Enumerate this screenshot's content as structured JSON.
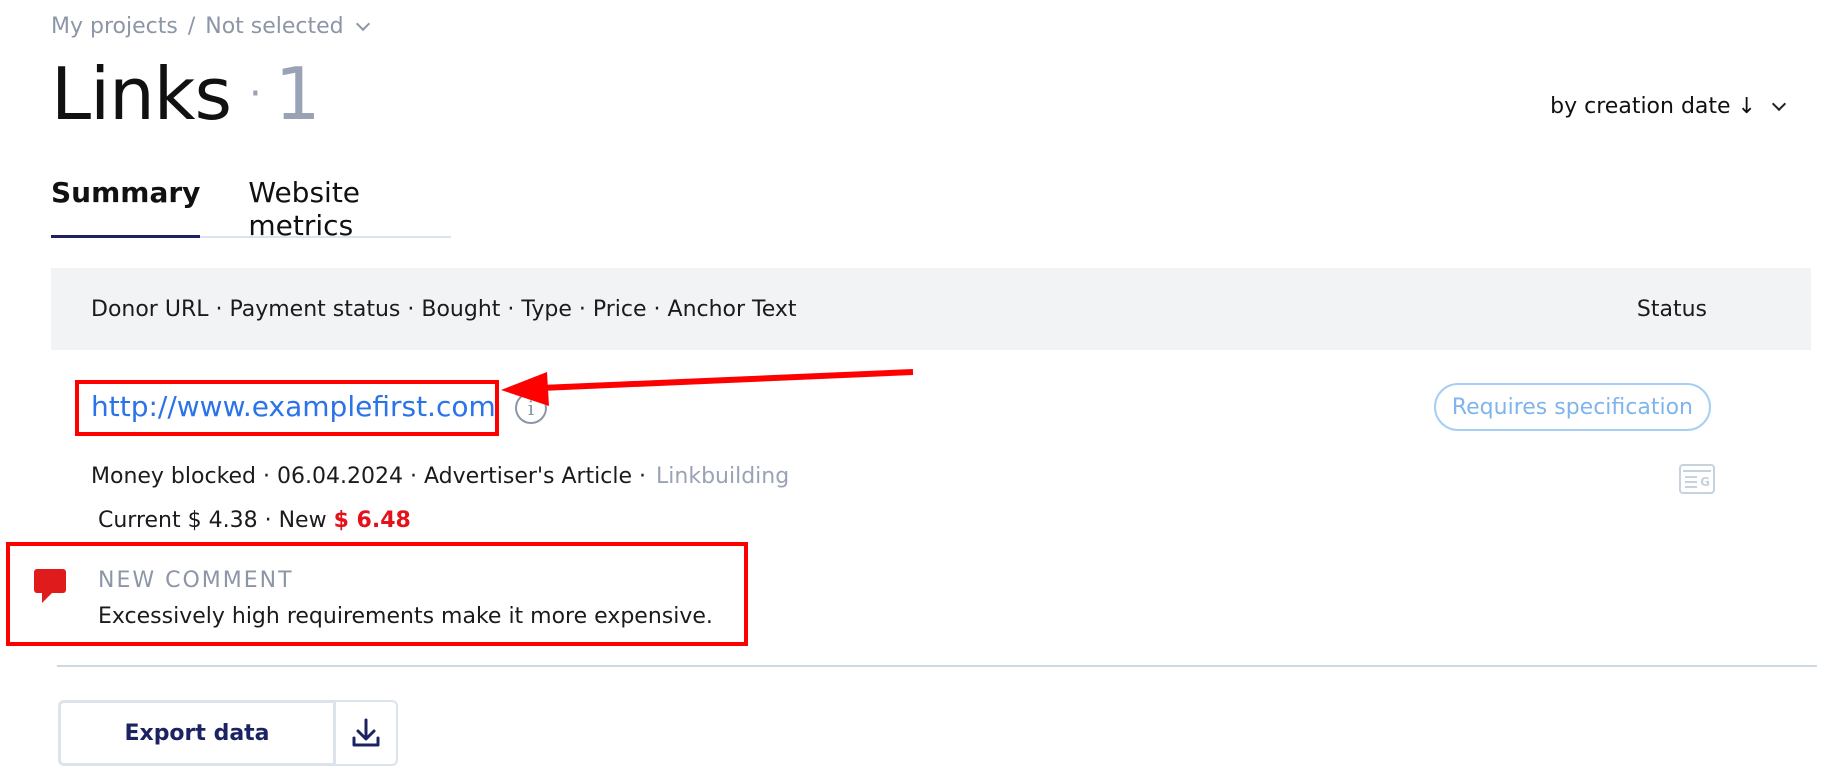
{
  "breadcrumb": {
    "root": "My projects",
    "separator": "/",
    "project": "Not selected"
  },
  "page": {
    "title": "Links",
    "dot": "·",
    "count": "1"
  },
  "sort": {
    "label": "by creation date ↓"
  },
  "tabs": [
    {
      "label": "Summary",
      "active": true
    },
    {
      "label": "Website metrics",
      "active": false
    }
  ],
  "table": {
    "columns_label": "Donor URL · Payment status · Bought · Type · Price · Anchor Text",
    "status_label": "Status"
  },
  "link": {
    "url": "http://www.examplefirst.com",
    "status": "Requires specification",
    "meta": "Money blocked · 06.04.2024 · Advertiser's Article ·",
    "type_link": "Linkbuilding",
    "price_prefix": "Current $ 4.38 · New",
    "price_new": "$ 6.48"
  },
  "comment": {
    "label": "NEW COMMENT",
    "text": "Excessively high requirements make it more expensive."
  },
  "export": {
    "label": "Export data"
  },
  "colors": {
    "accent": "#1c2363",
    "link": "#2a73e8",
    "alert": "#ff0000",
    "muted": "#8d96a7"
  },
  "icons": [
    "chevron-down-icon",
    "info-icon",
    "document-icon",
    "comment-icon",
    "download-icon",
    "arrow-annotation"
  ]
}
